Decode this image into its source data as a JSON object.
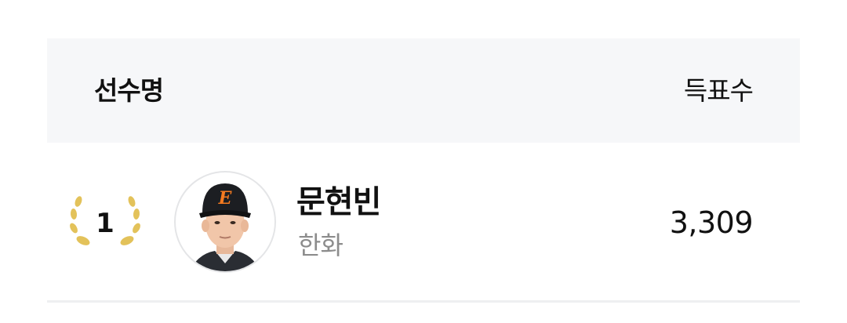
{
  "table": {
    "header": {
      "name_label": "선수명",
      "votes_label": "득표수"
    },
    "rows": [
      {
        "rank": "1",
        "rank_icon": "laurel-wreath-icon",
        "rank_color": "#e3c25a",
        "name": "문현빈",
        "team": "한화",
        "votes": "3,309"
      }
    ]
  }
}
